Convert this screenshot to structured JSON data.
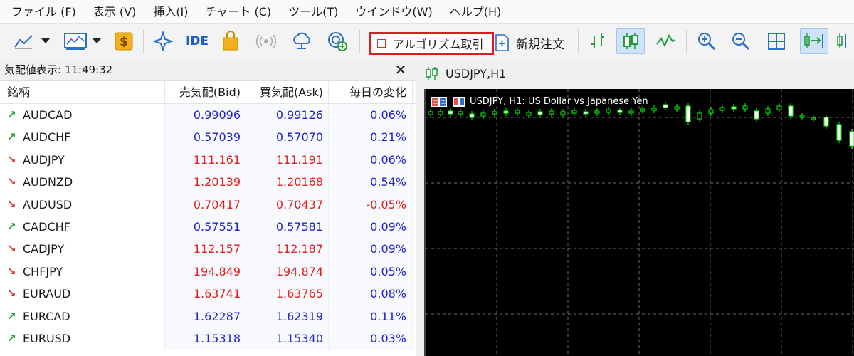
{
  "menu": [
    "ファイル (F)",
    "表示 (V)",
    "挿入(I)",
    "チャート (C)",
    "ツール(T)",
    "ウインドウ(W)",
    "ヘルプ(H)"
  ],
  "toolbar": {
    "ide_label": "IDE",
    "algo_trading_label": "アルゴリズム取引",
    "new_order_label": "新規注文"
  },
  "market_watch": {
    "title": "気配値表示: 11:49:32",
    "columns": [
      "銘柄",
      "売気配(Bid)",
      "買気配(Ask)",
      "毎日の変化"
    ],
    "rows": [
      {
        "symbol": "AUDCAD",
        "dir": "up",
        "bid": "0.99096",
        "ask": "0.99126",
        "change": "0.06%"
      },
      {
        "symbol": "AUDCHF",
        "dir": "up",
        "bid": "0.57039",
        "ask": "0.57070",
        "change": "0.21%"
      },
      {
        "symbol": "AUDJPY",
        "dir": "down",
        "bid": "111.161",
        "ask": "111.191",
        "change": "0.06%"
      },
      {
        "symbol": "AUDNZD",
        "dir": "down",
        "bid": "1.20139",
        "ask": "1.20168",
        "change": "0.54%"
      },
      {
        "symbol": "AUDUSD",
        "dir": "down",
        "bid": "0.70417",
        "ask": "0.70437",
        "change": "-0.05%"
      },
      {
        "symbol": "CADCHF",
        "dir": "up",
        "bid": "0.57551",
        "ask": "0.57581",
        "change": "0.09%"
      },
      {
        "symbol": "CADJPY",
        "dir": "down",
        "bid": "112.157",
        "ask": "112.187",
        "change": "0.09%"
      },
      {
        "symbol": "CHFJPY",
        "dir": "down",
        "bid": "194.849",
        "ask": "194.874",
        "change": "0.05%"
      },
      {
        "symbol": "EURAUD",
        "dir": "down",
        "bid": "1.63741",
        "ask": "1.63765",
        "change": "0.08%"
      },
      {
        "symbol": "EURCAD",
        "dir": "up",
        "bid": "1.62287",
        "ask": "1.62319",
        "change": "0.11%"
      },
      {
        "symbol": "EURUSD",
        "dir": "up",
        "bid": "1.15318",
        "ask": "1.15340",
        "change": "0.03%"
      }
    ]
  },
  "chart": {
    "tab_label": "USDJPY,H1",
    "title": "USDJPY, H1:  US Dollar vs Japanese Yen"
  },
  "colors": {
    "up": "#2222cc",
    "down": "#e01f1f",
    "candle": "#00ff00",
    "highlight_border": "#d81f1f"
  }
}
